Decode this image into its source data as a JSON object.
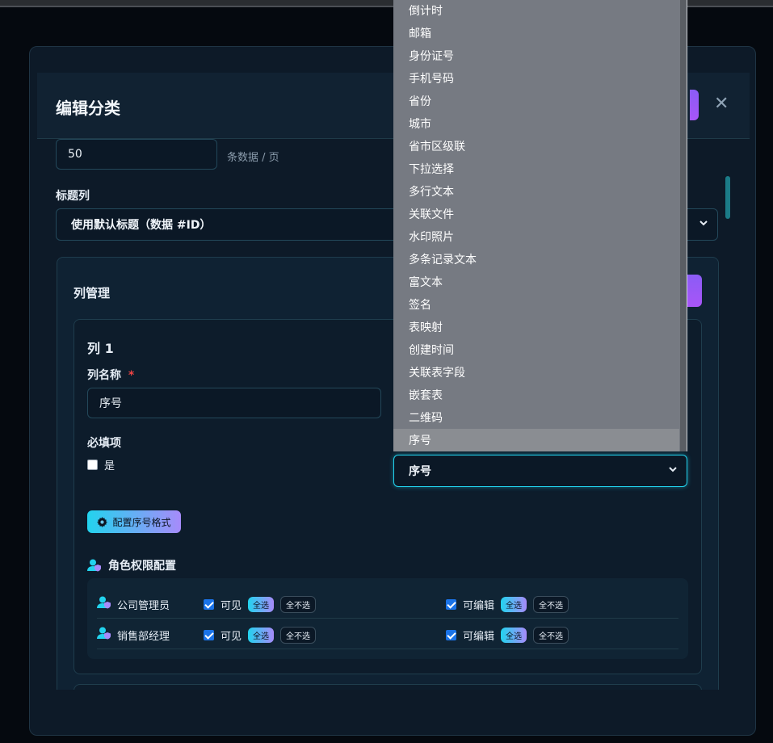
{
  "modal": {
    "title": "编辑分类",
    "close_glyph": "✕"
  },
  "pagination": {
    "page_size_value": "50",
    "page_size_suffix": "条数据 / 页"
  },
  "title_column": {
    "label": "标题列",
    "selected": "使用默认标题（数据 #ID）"
  },
  "column_management": {
    "title": "列管理",
    "column": {
      "heading": "列 1",
      "name_label": "列名称",
      "required_mark": "*",
      "name_value": "序号",
      "required_label": "必填项",
      "required_option": "是",
      "required_checked": false,
      "type_selected": "序号",
      "config_button": "配置序号格式",
      "role_section_title": "角色权限配置",
      "roles": [
        {
          "name": "公司管理员",
          "visible_label": "可见",
          "edit_label": "可编辑",
          "visible_checked": true,
          "edit_checked": true
        },
        {
          "name": "销售部经理",
          "visible_label": "可见",
          "edit_label": "可编辑",
          "visible_checked": true,
          "edit_checked": true
        }
      ],
      "select_all": "全选",
      "select_none": "全不选"
    }
  },
  "type_dropdown": {
    "options": [
      "倒计时",
      "邮箱",
      "身份证号",
      "手机号码",
      "省份",
      "城市",
      "省市区级联",
      "下拉选择",
      "多行文本",
      "关联文件",
      "水印照片",
      "多条记录文本",
      "富文本",
      "签名",
      "表映射",
      "创建时间",
      "关联表字段",
      "嵌套表",
      "二维码",
      "序号"
    ],
    "selected_index": 19
  },
  "colors": {
    "accent_cyan": "#22d3ee",
    "accent_purple": "#a78bfa",
    "checkbox_blue": "#1a73e8"
  },
  "icons": {
    "close": "close-icon",
    "gear": "gear-icon",
    "user_shield": "user-shield-icon",
    "chevron": "chevron-down-icon"
  }
}
